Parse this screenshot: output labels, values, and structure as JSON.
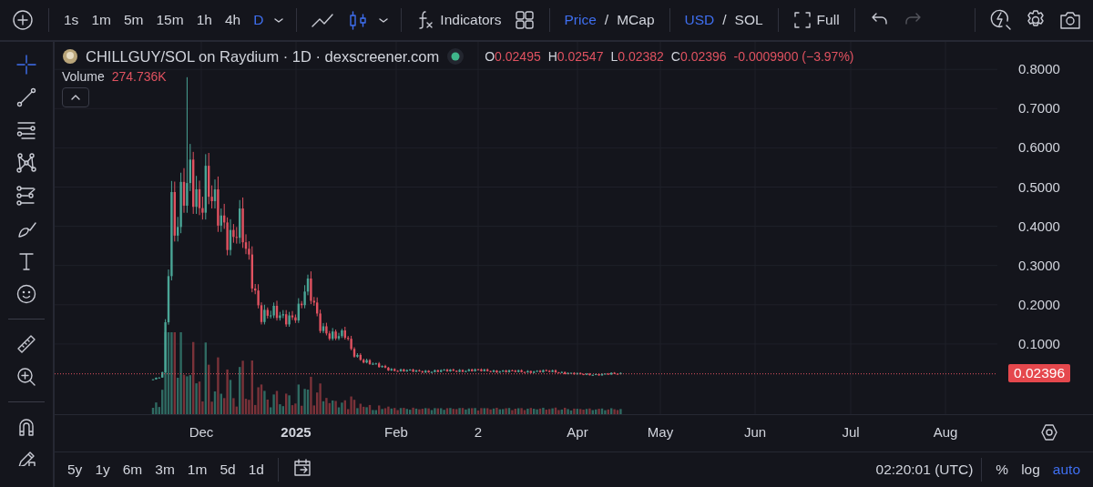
{
  "toolbar": {
    "intervals": [
      {
        "label": "1s",
        "selected": false
      },
      {
        "label": "1m",
        "selected": false
      },
      {
        "label": "5m",
        "selected": false
      },
      {
        "label": "15m",
        "selected": false
      },
      {
        "label": "1h",
        "selected": false
      },
      {
        "label": "4h",
        "selected": false
      },
      {
        "label": "D",
        "selected": true
      }
    ],
    "chart_types": [
      {
        "kind": "line",
        "selected": false
      },
      {
        "kind": "candles",
        "selected": true
      }
    ],
    "indicators_label": "Indicators",
    "price_toggle": [
      {
        "label": "Price",
        "selected": true
      },
      {
        "label": "MCap",
        "selected": false
      }
    ],
    "currency_toggle": [
      {
        "label": "USD",
        "selected": true
      },
      {
        "label": "SOL",
        "selected": false
      }
    ],
    "toggle_separator": "/",
    "full_label": "Full",
    "redo_disabled": true
  },
  "drawing_tools": [
    {
      "kind": "crosshair",
      "selected": true
    },
    {
      "kind": "trend",
      "selected": false
    },
    {
      "kind": "fib",
      "selected": false
    },
    {
      "kind": "pattern",
      "selected": false
    },
    {
      "kind": "forecast",
      "selected": false
    },
    {
      "kind": "brush",
      "selected": false
    },
    {
      "kind": "text",
      "selected": false
    },
    {
      "kind": "emoji",
      "selected": false
    },
    {
      "kind": "divider"
    },
    {
      "kind": "ruler",
      "selected": false
    },
    {
      "kind": "zoom",
      "selected": false
    },
    {
      "kind": "divider"
    },
    {
      "kind": "magnet",
      "selected": false
    },
    {
      "kind": "pencil",
      "selected": false
    }
  ],
  "legend": {
    "title": "CHILLGUY/SOL on Raydium · 1D · dexscreener.com",
    "ohlc": [
      {
        "key": "O",
        "value": "0.02495"
      },
      {
        "key": "H",
        "value": "0.02547"
      },
      {
        "key": "L",
        "value": "0.02382"
      },
      {
        "key": "C",
        "value": "0.02396"
      }
    ],
    "change": "-0.0009900 (−3.97%)",
    "volume_label": "Volume",
    "volume_value": "274.736K"
  },
  "price_axis": {
    "labels": [
      "0.8000",
      "0.7000",
      "0.6000",
      "0.5000",
      "0.4000",
      "0.3000",
      "0.2000",
      "0.1000"
    ],
    "last_price": "0.02396"
  },
  "time_axis": [
    {
      "label": "Dec",
      "bold": false
    },
    {
      "label": "2025",
      "bold": true
    },
    {
      "label": "Feb",
      "bold": false
    },
    {
      "label": "2",
      "bold": false
    },
    {
      "label": "Apr",
      "bold": false
    },
    {
      "label": "May",
      "bold": false
    },
    {
      "label": "Jun",
      "bold": false
    },
    {
      "label": "Jul",
      "bold": false
    },
    {
      "label": "Aug",
      "bold": false
    }
  ],
  "ranges": [
    "5y",
    "1y",
    "6m",
    "3m",
    "1m",
    "5d",
    "1d"
  ],
  "clock": "02:20:01 (UTC)",
  "scale_options": [
    {
      "label": "%",
      "selected": false
    },
    {
      "label": "log",
      "selected": false
    },
    {
      "label": "auto",
      "selected": true
    }
  ]
}
